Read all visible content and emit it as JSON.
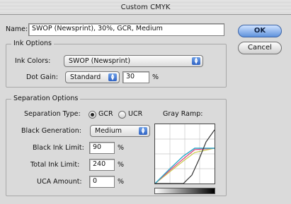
{
  "window": {
    "title": "Custom CMYK"
  },
  "name": {
    "label": "Name:",
    "value": "SWOP (Newsprint), 30%, GCR, Medium"
  },
  "buttons": {
    "ok": "OK",
    "cancel": "Cancel"
  },
  "ink_options": {
    "legend": "Ink Options",
    "ink_colors_label": "Ink Colors:",
    "ink_colors_value": "SWOP (Newsprint)",
    "dot_gain_label": "Dot Gain:",
    "dot_gain_mode": "Standard",
    "dot_gain_value": "30",
    "dot_gain_unit": "%"
  },
  "separation_options": {
    "legend": "Separation Options",
    "type_label": "Separation Type:",
    "gcr_label": "GCR",
    "ucr_label": "UCR",
    "selected_type": "GCR",
    "gray_ramp_label": "Gray Ramp:",
    "black_generation_label": "Black Generation:",
    "black_generation_value": "Medium",
    "black_ink_limit_label": "Black Ink Limit:",
    "black_ink_limit_value": "90",
    "total_ink_limit_label": "Total Ink Limit:",
    "total_ink_limit_value": "240",
    "uca_amount_label": "UCA Amount:",
    "uca_amount_value": "0",
    "percent_unit": "%"
  },
  "colors": {
    "cyan_curve": "#2aa9c9",
    "magenta_curve": "#e0407a",
    "yellow_curve": "#c8c84a",
    "black_curve": "#333333"
  }
}
